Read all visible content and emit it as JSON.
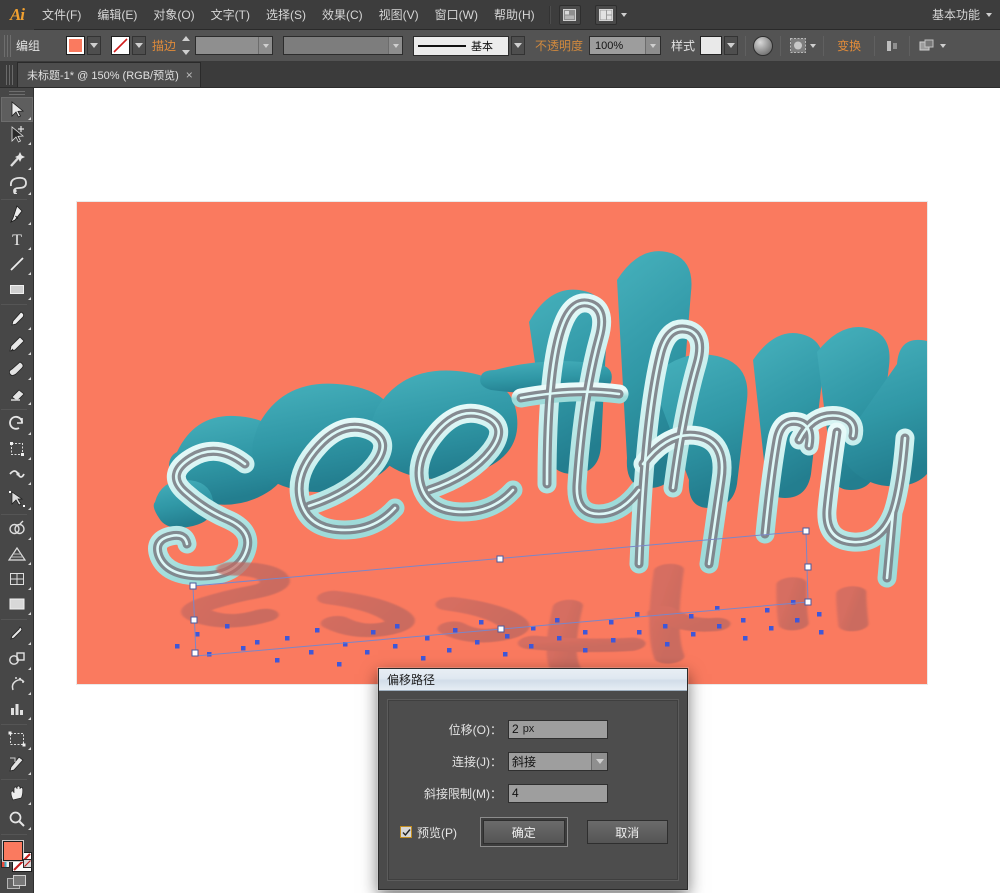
{
  "app": {
    "logo": "Ai",
    "workspace": "基本功能"
  },
  "menubar": {
    "items": [
      {
        "label": "文件(F)",
        "name": "menu-file"
      },
      {
        "label": "编辑(E)",
        "name": "menu-edit"
      },
      {
        "label": "对象(O)",
        "name": "menu-object"
      },
      {
        "label": "文字(T)",
        "name": "menu-type"
      },
      {
        "label": "选择(S)",
        "name": "menu-select"
      },
      {
        "label": "效果(C)",
        "name": "menu-effect"
      },
      {
        "label": "视图(V)",
        "name": "menu-view"
      },
      {
        "label": "窗口(W)",
        "name": "menu-window"
      },
      {
        "label": "帮助(H)",
        "name": "menu-help"
      }
    ],
    "bridge_icon": "bridge-icon",
    "arrange_icon": "arrange-documents-icon"
  },
  "controlbar": {
    "selection_label": "编组",
    "fill_color": "#fa7a5f",
    "stroke_color": "none",
    "stroke_label": "描边",
    "stroke_weight": "",
    "stroke_profile": "",
    "brush_definition": "基本",
    "opacity_label": "不透明度",
    "opacity_value": "100%",
    "style_label": "样式",
    "style_swatch": "#e9e9e9",
    "transform_label": "变换",
    "icons": {
      "fill_swatch": "fill-swatch-icon",
      "stroke_swatch": "stroke-none-icon",
      "recolor": "recolor-artwork-icon",
      "opacity_mask": "opacity-mask-icon",
      "align": "align-icon",
      "more_options": "more-options-icon"
    }
  },
  "tabbar": {
    "document_tab": "未标题-1* @ 150% (RGB/预览)",
    "close_glyph": "×"
  },
  "toolbar": {
    "tools": [
      {
        "name": "selection-tool",
        "label": "选择工具",
        "selected": true
      },
      {
        "name": "direct-selection-tool",
        "label": "直接选择工具",
        "selected": false
      },
      {
        "name": "magic-wand-tool",
        "label": "魔棒工具",
        "selected": false
      },
      {
        "name": "lasso-tool",
        "label": "套索工具",
        "selected": false
      },
      {
        "name": "pen-tool",
        "label": "钢笔工具",
        "selected": false
      },
      {
        "name": "type-tool",
        "label": "文字工具",
        "selected": false
      },
      {
        "name": "line-segment-tool",
        "label": "直线段工具",
        "selected": false
      },
      {
        "name": "rectangle-tool",
        "label": "矩形工具",
        "selected": false
      },
      {
        "name": "paintbrush-tool",
        "label": "画笔工具",
        "selected": false
      },
      {
        "name": "pencil-tool",
        "label": "铅笔工具",
        "selected": false
      },
      {
        "name": "blob-brush-tool",
        "label": "斑点画笔工具",
        "selected": false
      },
      {
        "name": "eraser-tool",
        "label": "橡皮擦工具",
        "selected": false
      },
      {
        "name": "rotate-tool",
        "label": "旋转工具",
        "selected": false
      },
      {
        "name": "scale-tool",
        "label": "比例缩放工具",
        "selected": false
      },
      {
        "name": "width-tool",
        "label": "宽度工具",
        "selected": false
      },
      {
        "name": "free-transform-tool",
        "label": "自由变换工具",
        "selected": false
      },
      {
        "name": "shape-builder-tool",
        "label": "形状生成器工具",
        "selected": false
      },
      {
        "name": "perspective-grid-tool",
        "label": "透视网格工具",
        "selected": false
      },
      {
        "name": "mesh-tool",
        "label": "网格工具",
        "selected": false
      },
      {
        "name": "gradient-tool",
        "label": "渐变工具",
        "selected": false
      },
      {
        "name": "eyedropper-tool",
        "label": "吸管工具",
        "selected": false
      },
      {
        "name": "blend-tool",
        "label": "混合工具",
        "selected": false
      },
      {
        "name": "symbol-sprayer-tool",
        "label": "符号喷枪工具",
        "selected": false
      },
      {
        "name": "column-graph-tool",
        "label": "柱形图工具",
        "selected": false
      },
      {
        "name": "artboard-tool",
        "label": "画板工具",
        "selected": false
      },
      {
        "name": "slice-tool",
        "label": "切片工具",
        "selected": false
      },
      {
        "name": "hand-tool",
        "label": "抓手工具",
        "selected": false
      },
      {
        "name": "zoom-tool",
        "label": "缩放工具",
        "selected": false
      }
    ],
    "fill_color": "#fa7a5f",
    "stroke_color": "none",
    "color_modes": [
      "color-icon",
      "gradient-icon",
      "none-icon"
    ],
    "screen_mode": "screen-mode-icon"
  },
  "artwork": {
    "background_color": "#fa7a5f",
    "text": "see thru",
    "text_color": "#2b9aaa",
    "highlight_color": "#d9f5f5",
    "shadow_color": "#8a6f74",
    "selection_color": "#3f57d8",
    "zoom": "150%"
  },
  "dialog": {
    "title": "偏移路径",
    "fields": [
      {
        "name": "offset-field",
        "label": "位移(O)：",
        "value": "2",
        "unit": "px",
        "type": "text"
      },
      {
        "name": "joins-field",
        "label": "连接(J)：",
        "value": "斜接",
        "unit": "",
        "type": "select"
      },
      {
        "name": "miter-limit-field",
        "label": "斜接限制(M)：",
        "value": "4",
        "unit": "",
        "type": "text"
      }
    ],
    "preview_label": "预览(P)",
    "preview_checked": true,
    "ok_label": "确定",
    "cancel_label": "取消"
  }
}
